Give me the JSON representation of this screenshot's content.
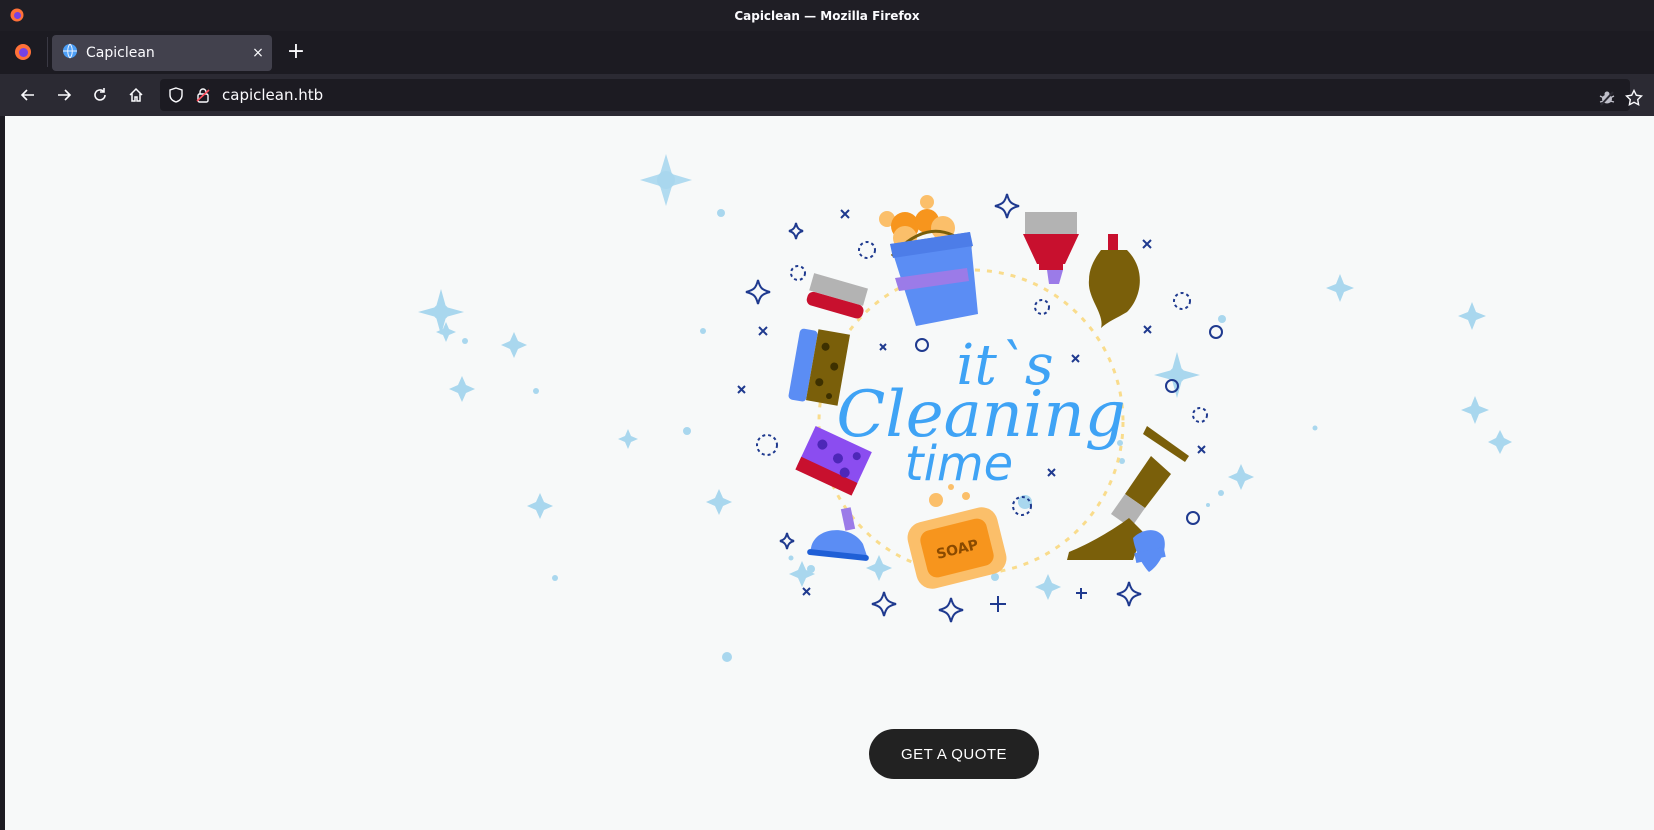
{
  "window": {
    "title": "Capiclean — Mozilla Firefox"
  },
  "tabs": [
    {
      "label": "Capiclean",
      "close": "×"
    }
  ],
  "new_tab": "+",
  "address": {
    "url": "capiclean.htb"
  },
  "hero": {
    "line1": "it`s",
    "line2": "Cleaning",
    "line3": "time",
    "soap_label": "SOAP"
  },
  "cta": {
    "label": "GET A QUOTE"
  },
  "colors": {
    "accent_blue": "#3fa3f5",
    "navy": "#1f3a8f",
    "dark_red": "#c8102e",
    "olive": "#7a5f0a",
    "soap_orange": "#f7951d",
    "button_bg": "#222222"
  },
  "icons": [
    "firefox-logo-icon",
    "back-arrow-icon",
    "forward-arrow-icon",
    "reload-icon",
    "home-icon",
    "shield-icon",
    "lock-icon",
    "extension-icon",
    "bookmark-star-icon"
  ]
}
